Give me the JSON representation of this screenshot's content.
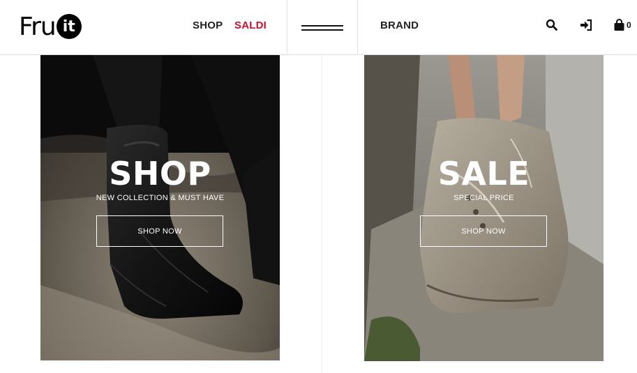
{
  "header": {
    "logo_text": "Fru",
    "logo_badge": "it",
    "nav": {
      "shop": "SHOP",
      "saldi": "SALDI",
      "brand": "BRAND"
    },
    "cart_count": "0",
    "accent_color": "#c8102e"
  },
  "icons": [
    "menu-icon",
    "search-icon",
    "login-icon",
    "shopping-bag-icon"
  ],
  "panels": {
    "shop": {
      "title": "SHOP",
      "subtitle": "NEW COLLECTION & MUST HAVE",
      "cta": "SHOP NOW"
    },
    "sale": {
      "title": "SALE",
      "subtitle": "SPECIAL PRICE",
      "cta": "SHOP NOW"
    }
  }
}
